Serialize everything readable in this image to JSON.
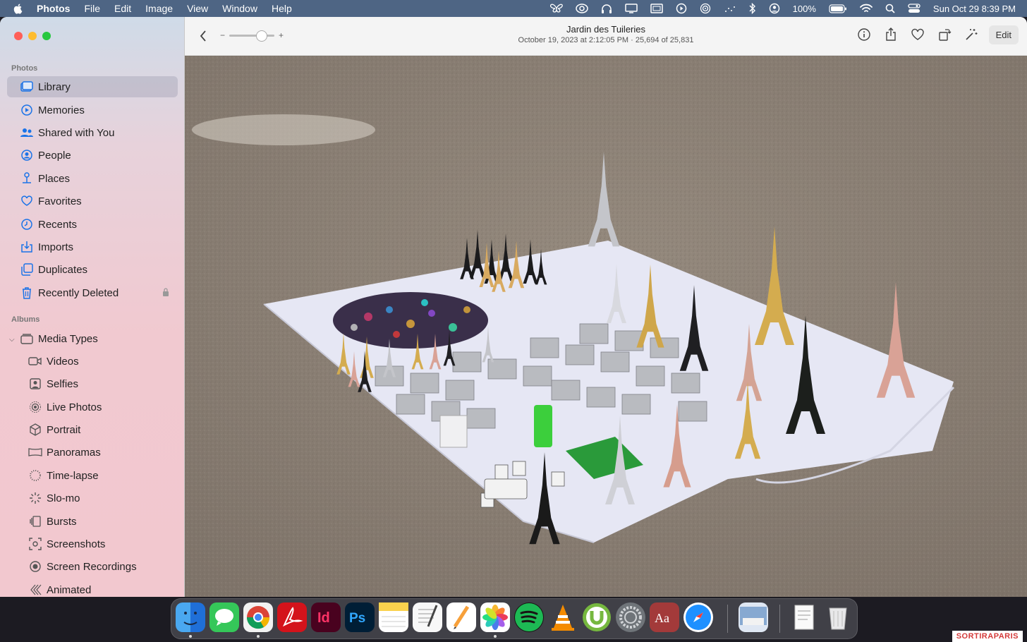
{
  "menubar": {
    "app_name": "Photos",
    "menus": [
      "File",
      "Edit",
      "Image",
      "View",
      "Window",
      "Help"
    ],
    "battery": "100%",
    "datetime": "Sun Oct 29  8:39 PM"
  },
  "sidebar": {
    "section_photos": "Photos",
    "items": [
      {
        "label": "Library"
      },
      {
        "label": "Memories"
      },
      {
        "label": "Shared with You"
      },
      {
        "label": "People"
      },
      {
        "label": "Places"
      },
      {
        "label": "Favorites"
      },
      {
        "label": "Recents"
      },
      {
        "label": "Imports"
      },
      {
        "label": "Duplicates"
      },
      {
        "label": "Recently Deleted"
      }
    ],
    "section_albums": "Albums",
    "media_types": "Media Types",
    "sub_items": [
      {
        "label": "Videos"
      },
      {
        "label": "Selfies"
      },
      {
        "label": "Live Photos"
      },
      {
        "label": "Portrait"
      },
      {
        "label": "Panoramas"
      },
      {
        "label": "Time-lapse"
      },
      {
        "label": "Slo-mo"
      },
      {
        "label": "Bursts"
      },
      {
        "label": "Screenshots"
      },
      {
        "label": "Screen Recordings"
      },
      {
        "label": "Animated"
      }
    ]
  },
  "toolbar": {
    "title": "Jardin des Tuileries",
    "subtitle": "October 19, 2023 at 2:12:05 PM  ·  25,694 of 25,831",
    "edit_label": "Edit",
    "zoom_minus": "−",
    "zoom_plus": "+"
  },
  "watermark": "SORTIRAPARIS"
}
